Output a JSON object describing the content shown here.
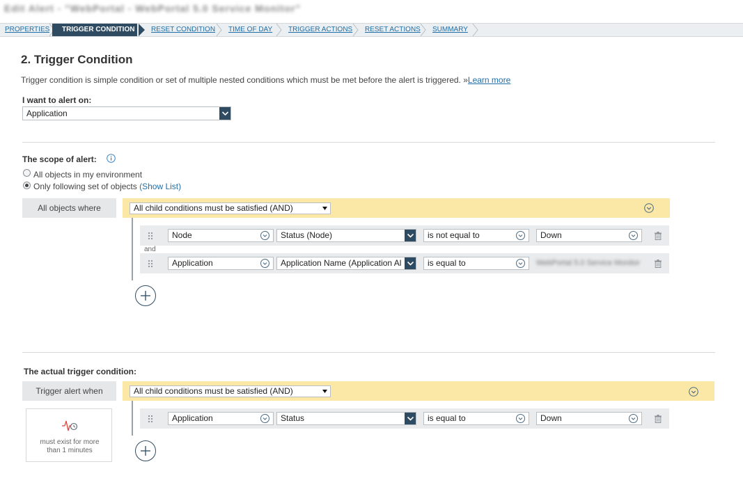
{
  "window_title": "Edit Alert - \"WebPortal - WebPortal 5.0 Service Monitor\"",
  "breadcrumb": [
    {
      "label": "PROPERTIES"
    },
    {
      "label": "TRIGGER CONDITION"
    },
    {
      "label": "RESET CONDITION"
    },
    {
      "label": "TIME OF DAY"
    },
    {
      "label": "TRIGGER ACTIONS"
    },
    {
      "label": "RESET ACTIONS"
    },
    {
      "label": "SUMMARY"
    }
  ],
  "section": {
    "title": "2. Trigger Condition",
    "description": "Trigger condition is simple condition or set of multiple nested conditions which must be met before the alert is triggered. »",
    "learn_more": "Learn more",
    "alert_on_label": "I want to alert on:",
    "alert_on_value": "Application"
  },
  "scope": {
    "label": "The scope of alert:",
    "option_all": "All objects in my environment",
    "option_only": "Only following set of objects",
    "show_list": "(Show List)",
    "where_label": "All objects where",
    "group_value": "All child conditions must be satisfied (AND)",
    "joiner": "and",
    "conditions": [
      {
        "object": "Node",
        "field": "Status (Node)",
        "operator": "is not equal to",
        "value": "Down"
      },
      {
        "object": "Application",
        "field": "Application Name (Application Al",
        "operator": "is equal to",
        "value": "WebPortal 5.0 Service Monitor"
      }
    ]
  },
  "trigger": {
    "label": "The actual trigger condition:",
    "when_label": "Trigger alert when",
    "group_value": "All child conditions must be satisfied (AND)",
    "duration_text": "must exist for more than 1 minutes",
    "conditions": [
      {
        "object": "Application",
        "field": "Status",
        "operator": "is equal to",
        "value": "Down"
      }
    ]
  },
  "colors": {
    "accent": "#2e4b62",
    "link": "#1f6ea7",
    "group_bar": "#fbe7a6",
    "row_bg": "#e9ebed"
  }
}
